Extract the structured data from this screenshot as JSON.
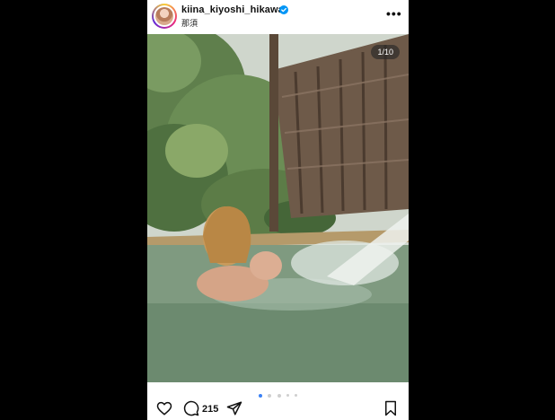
{
  "post": {
    "username": "kiina_kiyoshi_hikawa",
    "location": "那須",
    "verified": true,
    "more_label": "•••",
    "image_counter": "1/10",
    "comment_count": "215",
    "carousel": {
      "total_dots": 5,
      "active_index": 0
    }
  },
  "colors": {
    "accent_blue": "#3b82f6",
    "verified_blue": "#0095f6",
    "background": "#000000"
  },
  "icons": {
    "like": "heart-icon",
    "comment": "comment-bubble-icon",
    "share": "paper-plane-icon",
    "save": "bookmark-icon"
  }
}
